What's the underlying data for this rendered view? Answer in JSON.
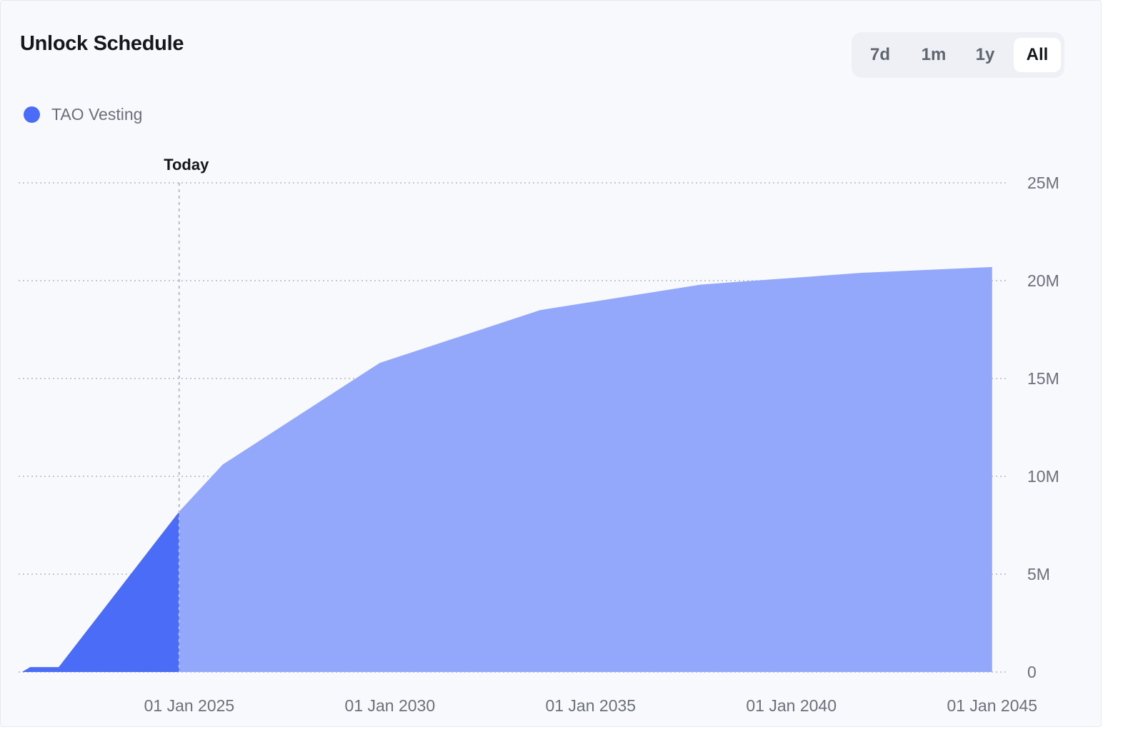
{
  "card": {
    "title": "Unlock Schedule",
    "range_buttons": [
      "7d",
      "1m",
      "1y",
      "All"
    ],
    "active_range": "All",
    "legend": [
      {
        "label": "TAO Vesting",
        "color": "#4a6cf7"
      }
    ]
  },
  "chart_data": {
    "type": "area",
    "title": "Unlock Schedule",
    "xlabel": "",
    "ylabel": "",
    "x_axis": "date",
    "xlim": [
      "2020-10-01",
      "2045-06-01"
    ],
    "ylim": [
      0,
      25000000
    ],
    "x_ticks": [
      "2025-01-01",
      "2030-01-01",
      "2035-01-01",
      "2040-01-01",
      "2045-01-01"
    ],
    "x_tick_labels": [
      "01 Jan 2025",
      "01 Jan 2030",
      "01 Jan 2035",
      "01 Jan 2040",
      "01 Jan 2045"
    ],
    "y_ticks": [
      0,
      5000000,
      10000000,
      15000000,
      20000000,
      25000000
    ],
    "y_tick_labels": [
      "0",
      "5M",
      "10M",
      "15M",
      "20M",
      "25M"
    ],
    "y_axis_position": "right",
    "grid": "horizontal-dotted",
    "legend_position": "top-left",
    "today_marker": {
      "label": "Today",
      "date": "2024-10-01"
    },
    "series": [
      {
        "name": "TAO Vesting",
        "color_unlocked": "#4a6cf7",
        "color_projected": "#93a8fb",
        "points": [
          {
            "x": "2020-11-01",
            "y": 0
          },
          {
            "x": "2021-01-15",
            "y": 250000
          },
          {
            "x": "2021-10-01",
            "y": 250000
          },
          {
            "x": "2024-10-01",
            "y": 8200000
          },
          {
            "x": "2025-11-01",
            "y": 10600000
          },
          {
            "x": "2029-10-01",
            "y": 15800000
          },
          {
            "x": "2033-10-01",
            "y": 18500000
          },
          {
            "x": "2037-10-01",
            "y": 19800000
          },
          {
            "x": "2041-10-01",
            "y": 20400000
          },
          {
            "x": "2045-01-01",
            "y": 20700000
          }
        ]
      }
    ]
  }
}
